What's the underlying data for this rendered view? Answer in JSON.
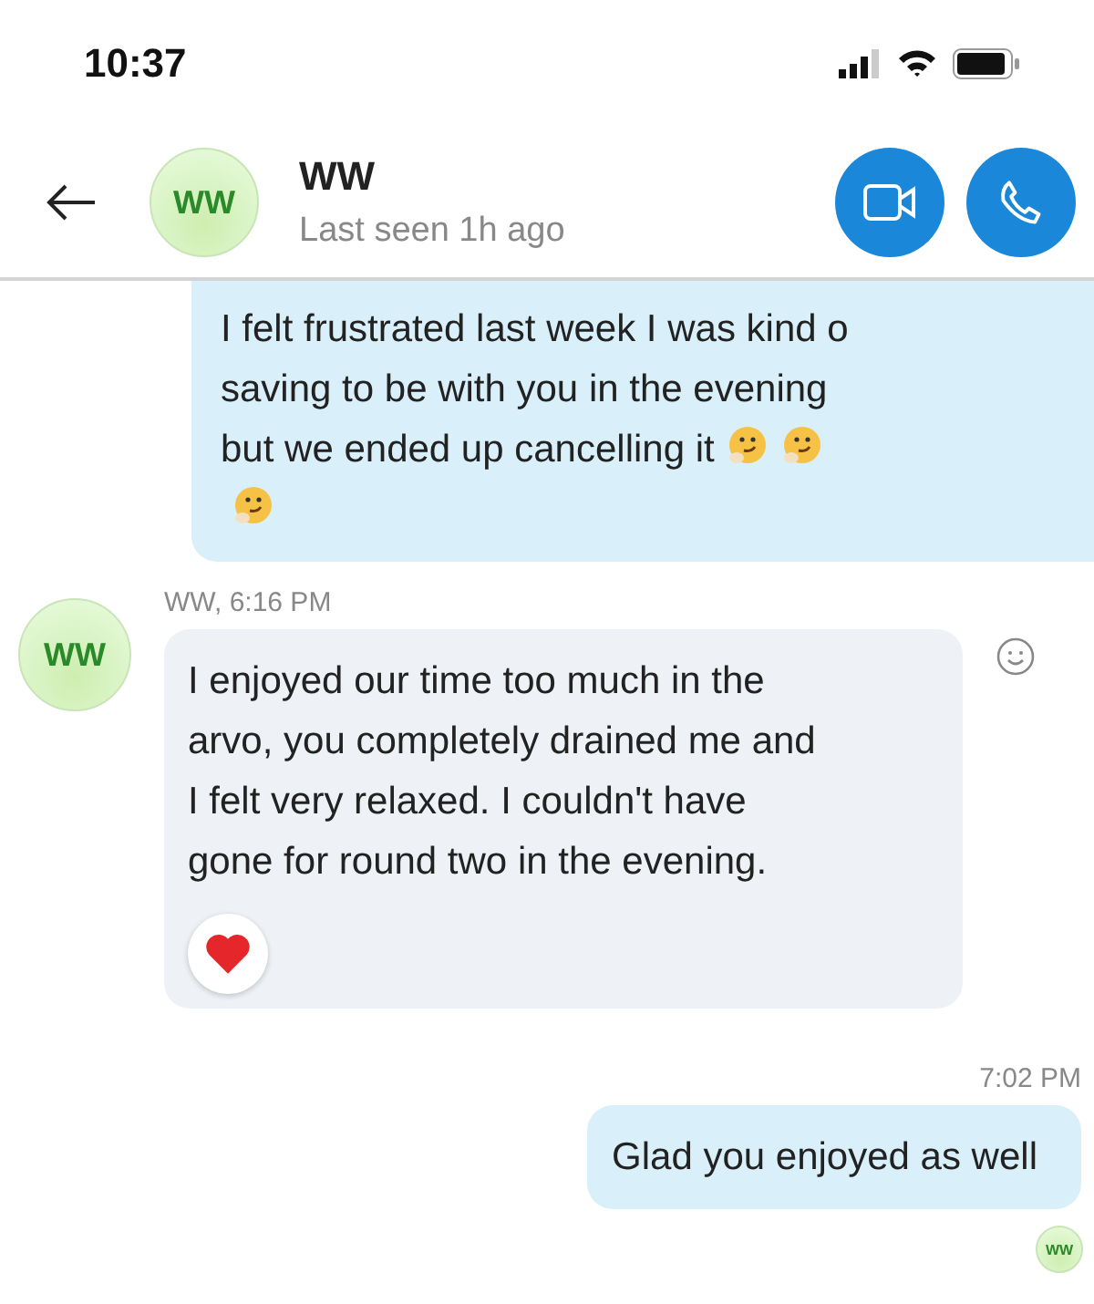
{
  "status_bar": {
    "time": "10:37"
  },
  "header": {
    "avatar_initials": "WW",
    "name": "WW",
    "subtitle": "Last seen 1h ago"
  },
  "messages": [
    {
      "kind": "sent",
      "lines": [
        "I felt frustrated last week I was kind o",
        "saving to be with you in the evening",
        "but we ended up cancelling it"
      ]
    },
    {
      "kind": "received",
      "avatar_initials": "WW",
      "meta": "WW, 6:16 PM",
      "lines": [
        "I enjoyed our time too much in the",
        "arvo, you completely drained me and",
        "I felt very relaxed. I couldn't have",
        "gone for round two in the evening."
      ],
      "liked": true
    },
    {
      "kind": "sent",
      "meta": "7:02 PM",
      "lines": [
        "Glad you enjoyed as well"
      ],
      "read_avatar": "WW"
    }
  ]
}
